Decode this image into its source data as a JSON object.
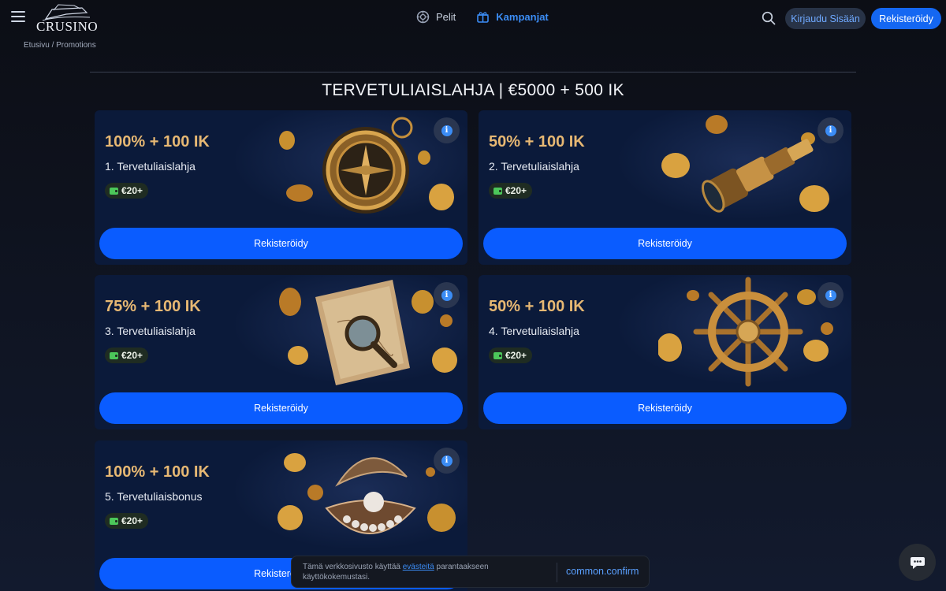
{
  "header": {
    "logo_text": "CRUSINO",
    "nav": [
      {
        "label": "Pelit",
        "icon": "games-icon"
      },
      {
        "label": "Kampanjat",
        "icon": "gift-icon"
      }
    ],
    "login_label": "Kirjaudu Sisään",
    "register_label": "Rekisteröidy"
  },
  "breadcrumb": "Etusivu / Promotions",
  "page_title": "TERVETULIAISLAHJA | €5000 + 500 IK",
  "cards": [
    {
      "amount": "100% + 100 IK",
      "name": "1.  Tervetuliaislahja",
      "min_deposit": "€20+",
      "button": "Rekisteröidy",
      "art": "compass"
    },
    {
      "amount": "50% + 100 IK",
      "name": "2.  Tervetuliaislahja",
      "min_deposit": "€20+",
      "button": "Rekisteröidy",
      "art": "spyglass"
    },
    {
      "amount": "75% + 100 IK",
      "name": "3.  Tervetuliaislahja",
      "min_deposit": "€20+",
      "button": "Rekisteröidy",
      "art": "map"
    },
    {
      "amount": "50% + 100 IK",
      "name": "4.  Tervetuliaislahja",
      "min_deposit": "€20+",
      "button": "Rekisteröidy",
      "art": "ship-wheel"
    },
    {
      "amount": "100% + 100 IK",
      "name": "5.  Tervetuliaisbonus",
      "min_deposit": "€20+",
      "button": "Rekisteröidy",
      "art": "pearl-shell"
    }
  ],
  "cookie": {
    "text_before": "Tämä verkkosivusto käyttää ",
    "link": "evästeitä",
    "text_after": " parantaakseen käyttökokemustasi.",
    "confirm": "common.confirm"
  },
  "colors": {
    "accent": "#0a5cff",
    "gold": "#e7b873",
    "card_bg": "#0b1a3a"
  }
}
